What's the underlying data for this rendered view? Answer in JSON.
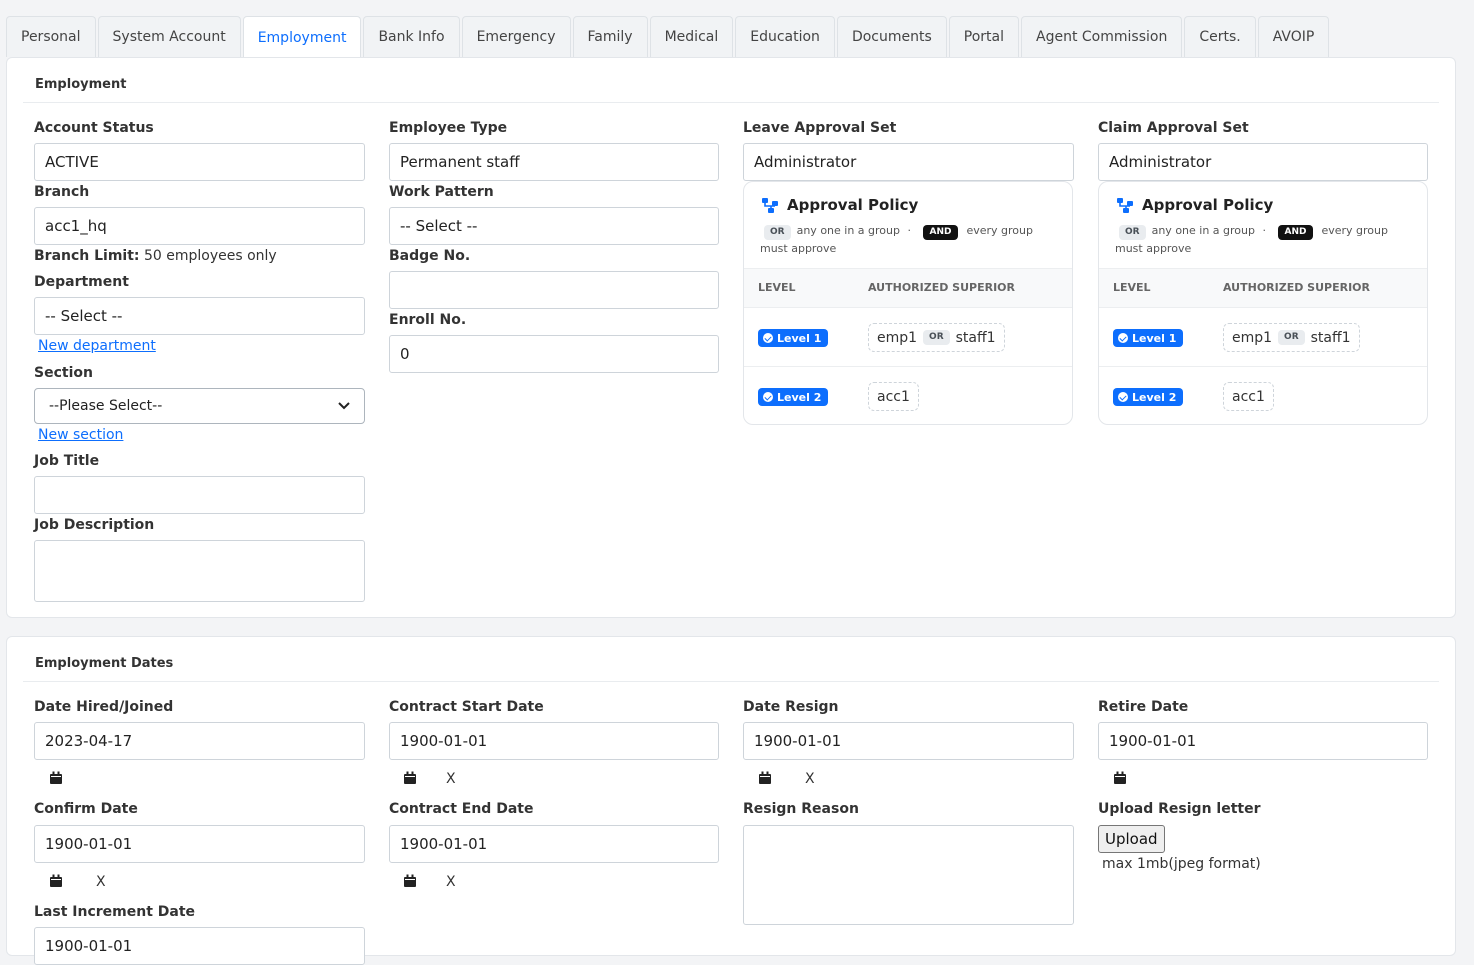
{
  "tabs": [
    "Personal",
    "System Account",
    "Employment",
    "Bank Info",
    "Emergency",
    "Family",
    "Medical",
    "Education",
    "Documents",
    "Portal",
    "Agent Commission",
    "Certs.",
    "AVOIP"
  ],
  "active_tab": "Employment",
  "employment": {
    "title": "Employment",
    "account_status": {
      "label": "Account Status",
      "value": "ACTIVE"
    },
    "branch": {
      "label": "Branch",
      "value": "acc1_hq"
    },
    "branch_limit": {
      "label": "Branch Limit:",
      "value": "50 employees only"
    },
    "department": {
      "label": "Department",
      "value": "-- Select --",
      "link": "New department"
    },
    "section": {
      "label": "Section",
      "value": "--Please Select--",
      "link": "New section"
    },
    "job_title": {
      "label": "Job Title",
      "value": ""
    },
    "job_description": {
      "label": "Job Description",
      "value": ""
    },
    "employee_type": {
      "label": "Employee Type",
      "value": "Permanent staff"
    },
    "work_pattern": {
      "label": "Work Pattern",
      "value": "-- Select --"
    },
    "badge_no": {
      "label": "Badge No.",
      "value": ""
    },
    "enroll_no": {
      "label": "Enroll No.",
      "value": "0"
    },
    "leave_approval_set": {
      "label": "Leave Approval Set",
      "value": "Administrator"
    },
    "claim_approval_set": {
      "label": "Claim Approval Set",
      "value": "Administrator"
    }
  },
  "policy": {
    "title": "Approval Policy",
    "or_chip": "OR",
    "or_text": "any one in a group",
    "dot": "·",
    "and_chip": "AND",
    "and_text": "every group must approve",
    "col_level": "LEVEL",
    "col_superior": "AUTHORIZED SUPERIOR",
    "levels": [
      {
        "level": "Level 1",
        "superiors": [
          "emp1",
          "staff1"
        ]
      },
      {
        "level": "Level 2",
        "superiors": [
          "acc1"
        ]
      }
    ]
  },
  "dates": {
    "title": "Employment Dates",
    "date_hired": {
      "label": "Date Hired/Joined",
      "value": "2023-04-17"
    },
    "contract_start": {
      "label": "Contract Start Date",
      "value": "1900-01-01"
    },
    "date_resign": {
      "label": "Date Resign",
      "value": "1900-01-01"
    },
    "retire_date": {
      "label": "Retire Date",
      "value": "1900-01-01"
    },
    "confirm_date": {
      "label": "Confirm Date",
      "value": "1900-01-01"
    },
    "contract_end": {
      "label": "Contract End Date",
      "value": "1900-01-01"
    },
    "resign_reason": {
      "label": "Resign Reason",
      "value": ""
    },
    "upload_resign": {
      "label": "Upload Resign letter",
      "button": "Upload",
      "hint": "max 1mb(jpeg format)"
    },
    "last_increment": {
      "label": "Last Increment Date",
      "value": "1900-01-01"
    },
    "clear_mark": "X"
  },
  "icons": {
    "calendar": "calendar-icon",
    "policy": "sitemap-icon",
    "chevron": "chevron-down-icon",
    "check": "check-circle-icon"
  },
  "colors": {
    "accent": "#0d6efd",
    "and_chip": "#111111"
  }
}
